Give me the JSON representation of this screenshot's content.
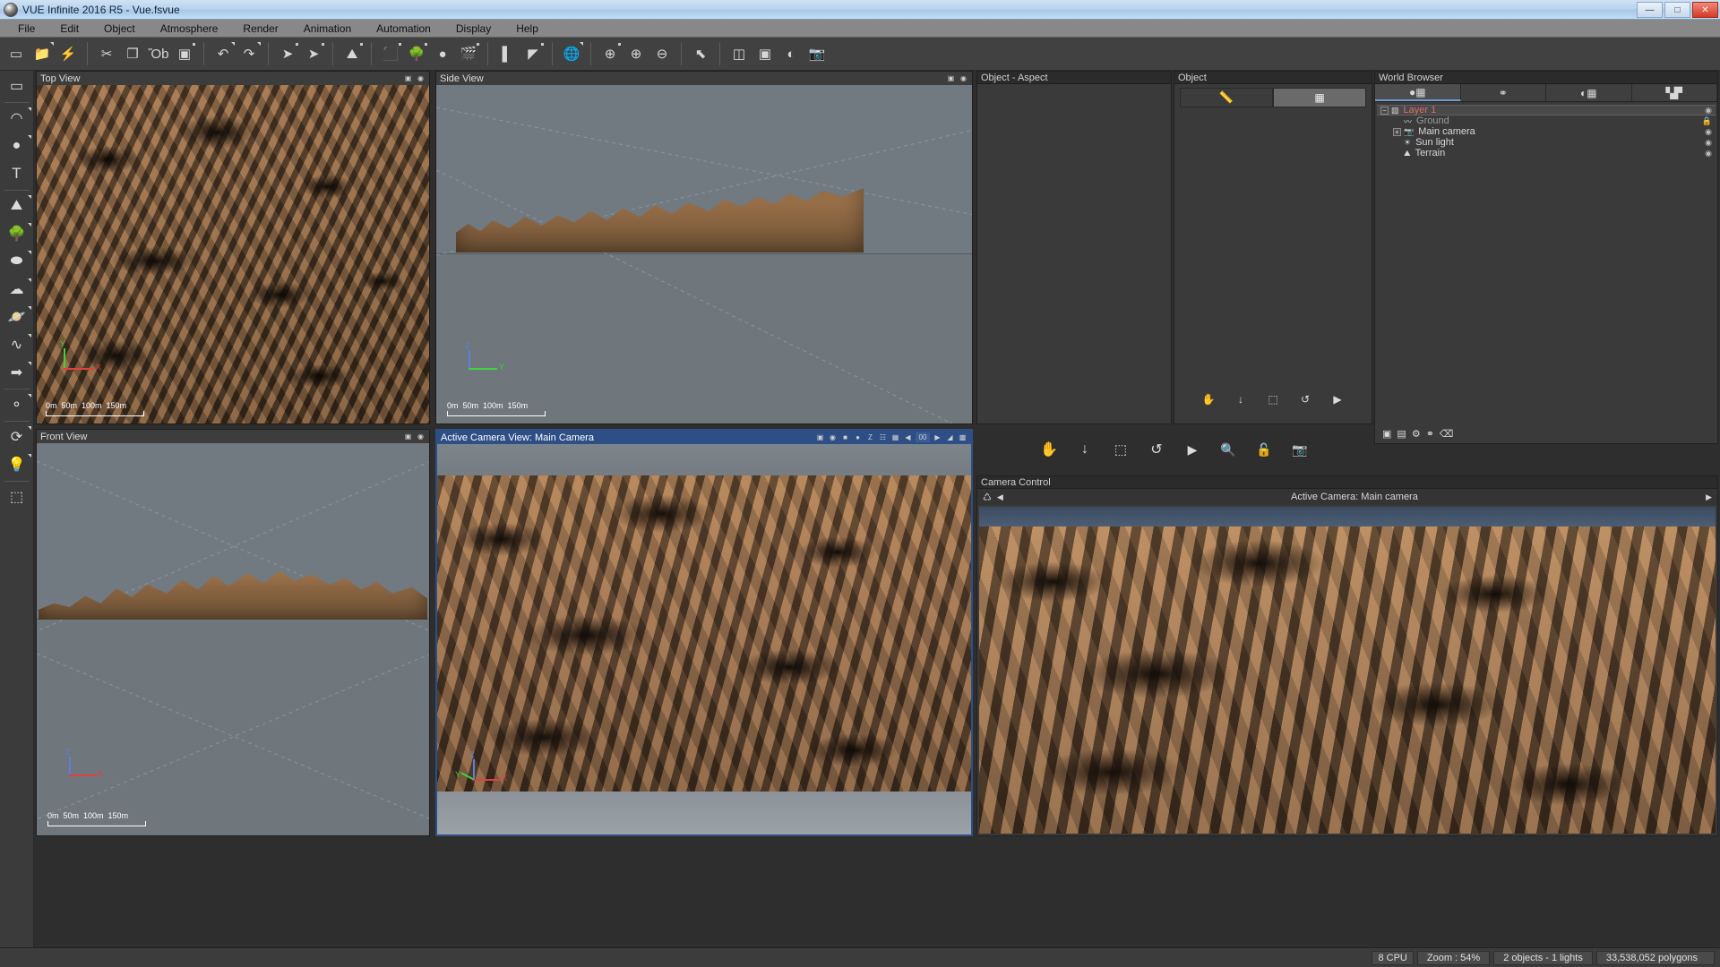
{
  "window": {
    "title": "VUE Infinite 2016 R5 - Vue.fsvue",
    "app_icon": "app-sphere-icon",
    "controls": {
      "minimize": "—",
      "maximize": "□",
      "close": "✕"
    }
  },
  "menu": [
    "File",
    "Edit",
    "Object",
    "Atmosphere",
    "Render",
    "Animation",
    "Automation",
    "Display",
    "Help"
  ],
  "toolbar": [
    {
      "name": "new-document-icon",
      "glyph": "▭",
      "arrow": false,
      "dot": false
    },
    {
      "name": "open-folder-icon",
      "glyph": "📁",
      "arrow": true,
      "dot": false
    },
    {
      "name": "quick-load-icon",
      "glyph": "⚡",
      "arrow": false,
      "dot": false
    },
    {
      "name": "cut-icon",
      "glyph": "✂",
      "arrow": false,
      "dot": false
    },
    {
      "name": "copy-icon",
      "glyph": "❐",
      "arrow": false,
      "dot": false
    },
    {
      "name": "paste-icon",
      "glyph": "Ὄb",
      "arrow": false,
      "dot": false
    },
    {
      "name": "duplicate-icon",
      "glyph": "▣",
      "arrow": false,
      "dot": true
    },
    {
      "name": "undo-icon",
      "glyph": "↶",
      "arrow": true,
      "dot": false
    },
    {
      "name": "redo-icon",
      "glyph": "↷",
      "arrow": true,
      "dot": false
    },
    {
      "name": "select-tool-icon",
      "glyph": "➤",
      "arrow": false,
      "dot": true
    },
    {
      "name": "move-tool-icon",
      "glyph": "➤",
      "arrow": false,
      "dot": true
    },
    {
      "name": "terrain-edit-icon",
      "glyph": "⛰",
      "arrow": false,
      "dot": true
    },
    {
      "name": "object-cube-icon",
      "glyph": "⬛",
      "arrow": false,
      "dot": true
    },
    {
      "name": "ecosystem-paint-icon",
      "glyph": "🌳",
      "arrow": false,
      "dot": true
    },
    {
      "name": "material-spheres-icon",
      "glyph": "●",
      "arrow": false,
      "dot": false
    },
    {
      "name": "animation-clapper-icon",
      "glyph": "🎬",
      "arrow": false,
      "dot": true
    },
    {
      "name": "align-icon",
      "glyph": "▌",
      "arrow": false,
      "dot": false
    },
    {
      "name": "mirror-icon",
      "glyph": "◤",
      "arrow": false,
      "dot": true
    },
    {
      "name": "globe-icon",
      "glyph": "🌐",
      "arrow": true,
      "dot": false
    },
    {
      "name": "zoom-fit-icon",
      "glyph": "⊕",
      "arrow": false,
      "dot": true
    },
    {
      "name": "zoom-in-icon",
      "glyph": "⊕",
      "arrow": false,
      "dot": false
    },
    {
      "name": "zoom-out-icon",
      "glyph": "⊖",
      "arrow": false,
      "dot": false
    },
    {
      "name": "pointer-region-icon",
      "glyph": "⬉",
      "arrow": false,
      "dot": false
    },
    {
      "name": "layout-quad-icon",
      "glyph": "◫",
      "arrow": false,
      "dot": false
    },
    {
      "name": "layout-single-icon",
      "glyph": "▣",
      "arrow": false,
      "dot": false
    },
    {
      "name": "render-preview-icon",
      "glyph": "◐",
      "arrow": false,
      "dot": false
    },
    {
      "name": "render-camera-icon",
      "glyph": "📷",
      "arrow": false,
      "dot": false
    }
  ],
  "left_toolbar": [
    {
      "name": "new-scene-icon",
      "glyph": "▭",
      "arrow": false
    },
    {
      "name": "water-plane-icon",
      "glyph": "◠",
      "arrow": true
    },
    {
      "name": "sphere-primitive-icon",
      "glyph": "●",
      "arrow": true
    },
    {
      "name": "text-object-icon",
      "glyph": "T",
      "arrow": false
    },
    {
      "name": "terrain-icon",
      "glyph": "⛰",
      "arrow": true
    },
    {
      "name": "plant-tree-icon",
      "glyph": "🌳",
      "arrow": true
    },
    {
      "name": "rock-icon",
      "glyph": "⬬",
      "arrow": true
    },
    {
      "name": "cloud-icon",
      "glyph": "☁",
      "arrow": true
    },
    {
      "name": "planet-icon",
      "glyph": "🪐",
      "arrow": true
    },
    {
      "name": "spline-curve-icon",
      "glyph": "∿",
      "arrow": true
    },
    {
      "name": "extrude-cube-icon",
      "glyph": "➡",
      "arrow": true
    },
    {
      "name": "metablob-icon",
      "glyph": "⚬",
      "arrow": true
    },
    {
      "name": "spiral-twist-icon",
      "glyph": "⟳",
      "arrow": true
    },
    {
      "name": "light-bulb-icon",
      "glyph": "💡",
      "arrow": true
    },
    {
      "name": "group-objects-icon",
      "glyph": "⬚",
      "arrow": false
    }
  ],
  "viewports": [
    {
      "name": "top-view",
      "title": "Top View",
      "active": false,
      "icons": [
        "camera-icon",
        "snapshot-icon"
      ],
      "axes": [
        {
          "label": "Y",
          "color": "#3fd43f"
        },
        {
          "label": "X",
          "color": "#e04040"
        }
      ],
      "scale": {
        "ticks": [
          "0m",
          "50m",
          "100m",
          "150m"
        ]
      }
    },
    {
      "name": "side-view",
      "title": "Side View",
      "active": false,
      "icons": [
        "camera-icon",
        "snapshot-icon"
      ],
      "axes": [
        {
          "label": "Z",
          "color": "#5a7fe0"
        },
        {
          "label": "Y",
          "color": "#3fd43f"
        }
      ],
      "scale": {
        "ticks": [
          "0m",
          "50m",
          "100m",
          "150m"
        ]
      }
    },
    {
      "name": "front-view",
      "title": "Front View",
      "active": false,
      "icons": [
        "camera-icon",
        "snapshot-icon"
      ],
      "axes": [
        {
          "label": "Z",
          "color": "#5a7fe0"
        },
        {
          "label": "X",
          "color": "#e04040"
        }
      ],
      "scale": {
        "ticks": [
          "0m",
          "50m",
          "100m",
          "150m"
        ]
      }
    },
    {
      "name": "active-camera-view",
      "title": "Active Camera View: Main Camera",
      "active": true,
      "icons": [
        "camera-icon",
        "snapshot-icon",
        "display-mode-icon",
        "point-icon",
        "z-buffer-icon",
        "wireframe-icon",
        "render-region-icon",
        "prev-frame-icon",
        "frame-counter",
        "next-frame-icon",
        "brush-icon",
        "fullscreen-icon"
      ],
      "frame_value": "00",
      "axes": [
        {
          "label": "Z",
          "color": "#5a7fe0"
        },
        {
          "label": "Y",
          "color": "#3fd43f"
        },
        {
          "label": "X",
          "color": "#e04040"
        }
      ],
      "scale": {
        "ticks": []
      }
    }
  ],
  "panels": {
    "object_aspect": {
      "title": "Object - Aspect"
    },
    "object": {
      "title": "Object",
      "tabs": [
        {
          "name": "numerics-tab",
          "icon": "ruler-icon",
          "selected": true
        },
        {
          "name": "transform-tab",
          "icon": "cubes-icon",
          "selected": false
        }
      ],
      "tools": [
        {
          "name": "pan-tool",
          "icon": "hand-icon",
          "glyph": "✋"
        },
        {
          "name": "drop-tool",
          "icon": "arrow-down-icon",
          "glyph": "↓"
        },
        {
          "name": "select-region-tool",
          "icon": "dotted-square-icon",
          "glyph": "⬚"
        },
        {
          "name": "rotate-tool",
          "icon": "rotate-icon",
          "glyph": "↺"
        },
        {
          "name": "play-tool",
          "icon": "play-icon",
          "glyph": "▶"
        },
        {
          "name": "zoom-tool",
          "icon": "magnifier-icon",
          "glyph": "🔍"
        },
        {
          "name": "lock-tool",
          "icon": "lock-icon",
          "glyph": "🔓"
        },
        {
          "name": "camera-tool",
          "icon": "camera-down-icon",
          "glyph": "📷"
        }
      ]
    },
    "world_browser": {
      "title": "World Browser",
      "tabs": [
        {
          "name": "objects-tab",
          "icon": "objects-icon",
          "selected": true
        },
        {
          "name": "links-tab",
          "icon": "links-icon",
          "selected": false
        },
        {
          "name": "materials-tab",
          "icon": "checker-sphere-icon",
          "selected": false
        },
        {
          "name": "layers-tab",
          "icon": "bars-icon",
          "selected": false
        }
      ],
      "tree": [
        {
          "label": "Layer 1",
          "icon": "layer-icon",
          "depth": 0,
          "expandable": true,
          "expanded": true,
          "color": "#e06a6a",
          "visibility": "eye-icon"
        },
        {
          "label": "Ground",
          "icon": "ground-icon",
          "depth": 1,
          "expandable": false,
          "expanded": false,
          "color": "#9a9a9a",
          "visibility": "lock-icon"
        },
        {
          "label": "Main camera",
          "icon": "camera-icon",
          "depth": 1,
          "expandable": true,
          "expanded": false,
          "color": "#d8d8d8",
          "visibility": "eye-icon"
        },
        {
          "label": "Sun light",
          "icon": "sun-icon",
          "depth": 1,
          "expandable": false,
          "expanded": false,
          "color": "#d8d8d8",
          "visibility": "eye-icon"
        },
        {
          "label": "Terrain",
          "icon": "terrain-icon",
          "depth": 1,
          "expandable": false,
          "expanded": false,
          "color": "#d8d8d8",
          "visibility": "eye-icon"
        }
      ],
      "footer_icons": [
        "new-layer-icon",
        "duplicate-layer-icon",
        "settings-icon",
        "link-icon",
        "delete-icon"
      ]
    },
    "camera_control": {
      "title": "Camera Control",
      "icon": "camera-switch-icon",
      "prev": "◀",
      "label": "Active Camera: Main camera",
      "next": "▶"
    }
  },
  "statusbar": [
    {
      "name": "cpu-count",
      "text": "8 CPU"
    },
    {
      "name": "zoom-level",
      "text": "Zoom : 54%"
    },
    {
      "name": "object-count",
      "text": "2 objects - 1 lights"
    },
    {
      "name": "polygon-count",
      "text": "33,538,052 polygons"
    }
  ],
  "colors": {
    "accent_blue": "#2d4f86",
    "layer_red": "#e06a6a",
    "terrain_brown": "#9a7050",
    "sky_gray": "#6b7278"
  }
}
